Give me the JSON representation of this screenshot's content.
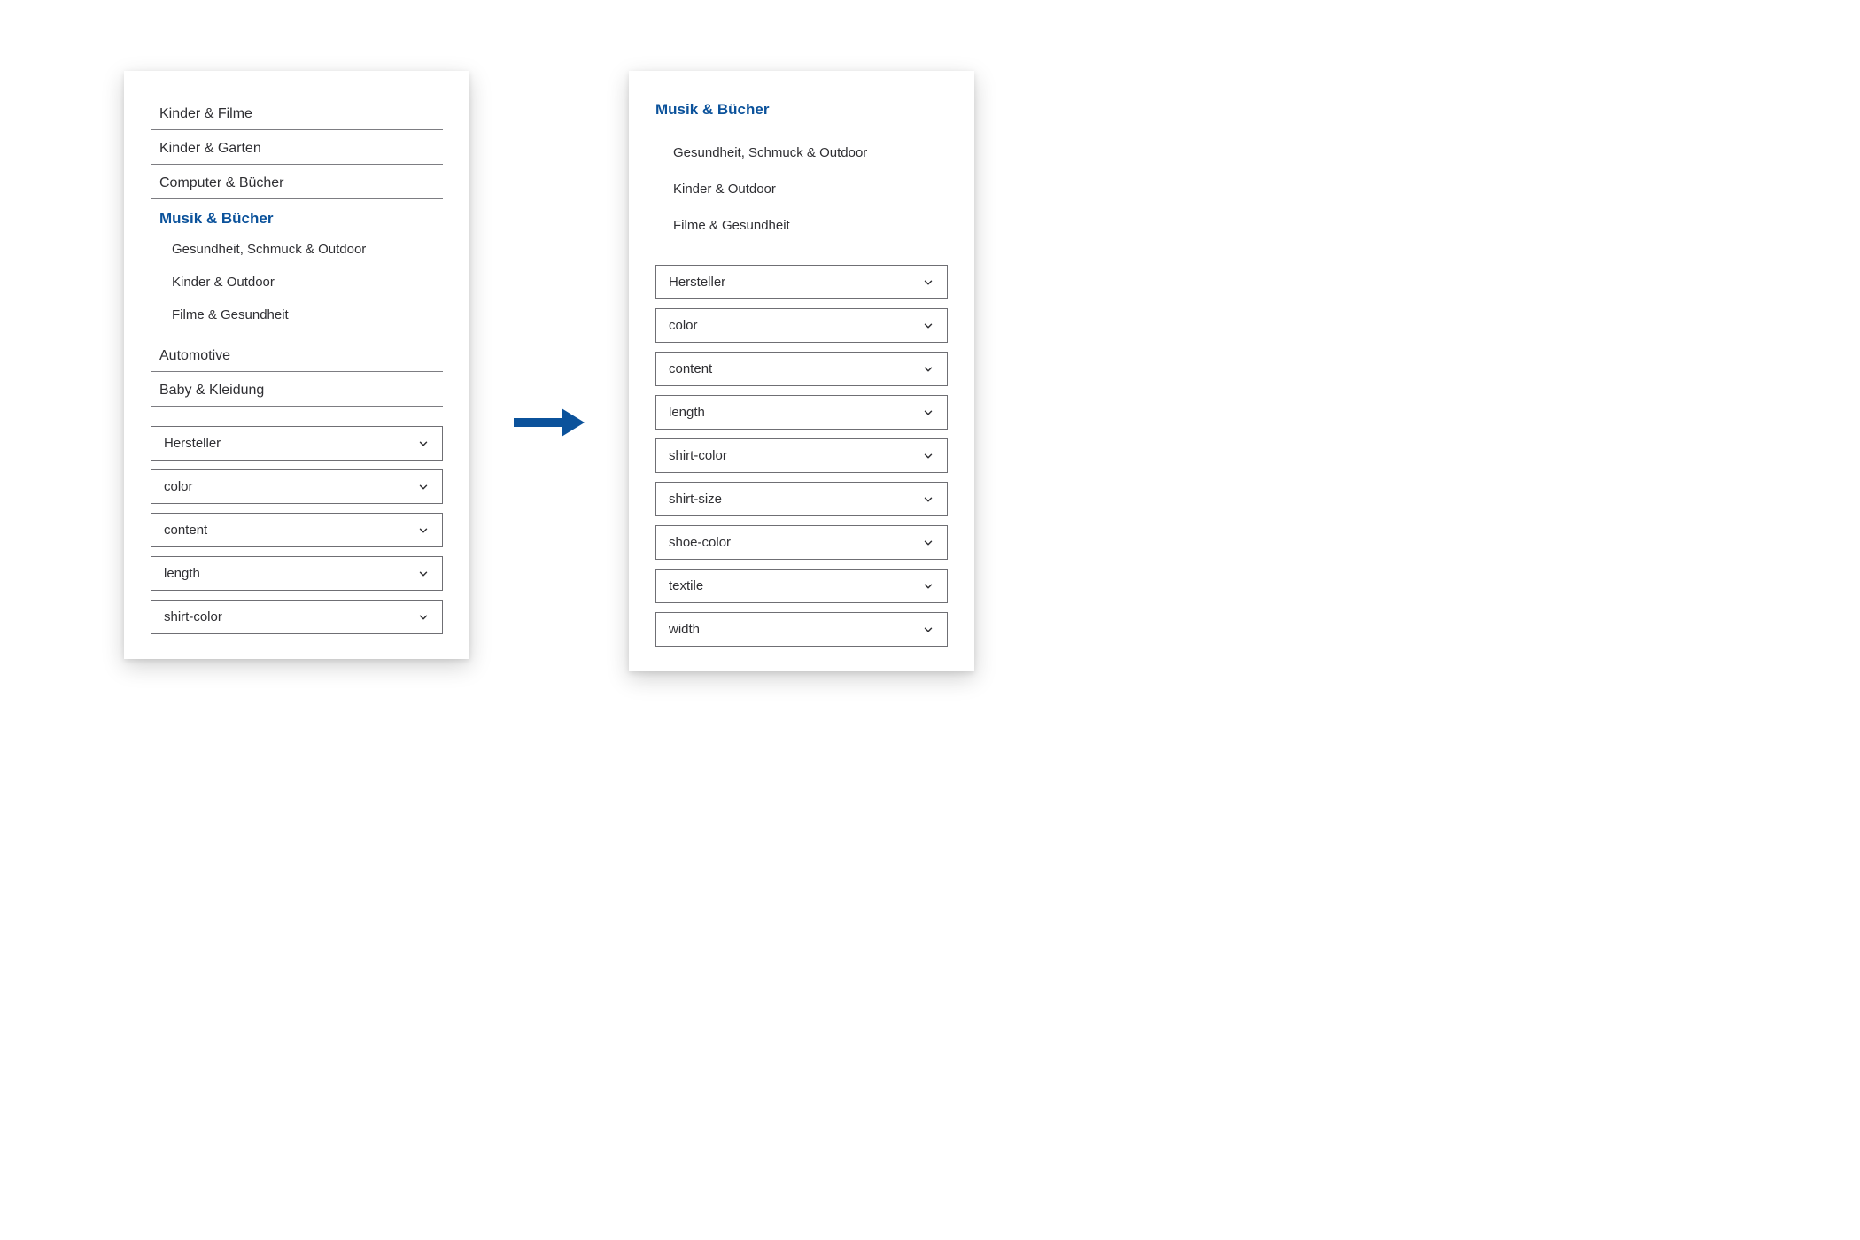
{
  "left": {
    "nav": [
      {
        "label": "Kinder & Filme",
        "active": false
      },
      {
        "label": "Kinder & Garten",
        "active": false
      },
      {
        "label": "Computer & Bücher",
        "active": false
      },
      {
        "label": "Musik & Bücher",
        "active": true,
        "children": [
          "Gesundheit, Schmuck & Outdoor",
          "Kinder & Outdoor",
          "Filme & Gesundheit"
        ]
      },
      {
        "label": "Automotive",
        "active": false
      },
      {
        "label": "Baby & Kleidung",
        "active": false
      }
    ],
    "filters": [
      "Hersteller",
      "color",
      "content",
      "length",
      "shirt-color"
    ]
  },
  "right": {
    "heading": "Musik & Bücher",
    "children": [
      "Gesundheit, Schmuck & Outdoor",
      "Kinder & Outdoor",
      "Filme & Gesundheit"
    ],
    "filters": [
      "Hersteller",
      "color",
      "content",
      "length",
      "shirt-color",
      "shirt-size",
      "shoe-color",
      "textile",
      "width"
    ]
  },
  "colors": {
    "accent": "#0b529b"
  }
}
